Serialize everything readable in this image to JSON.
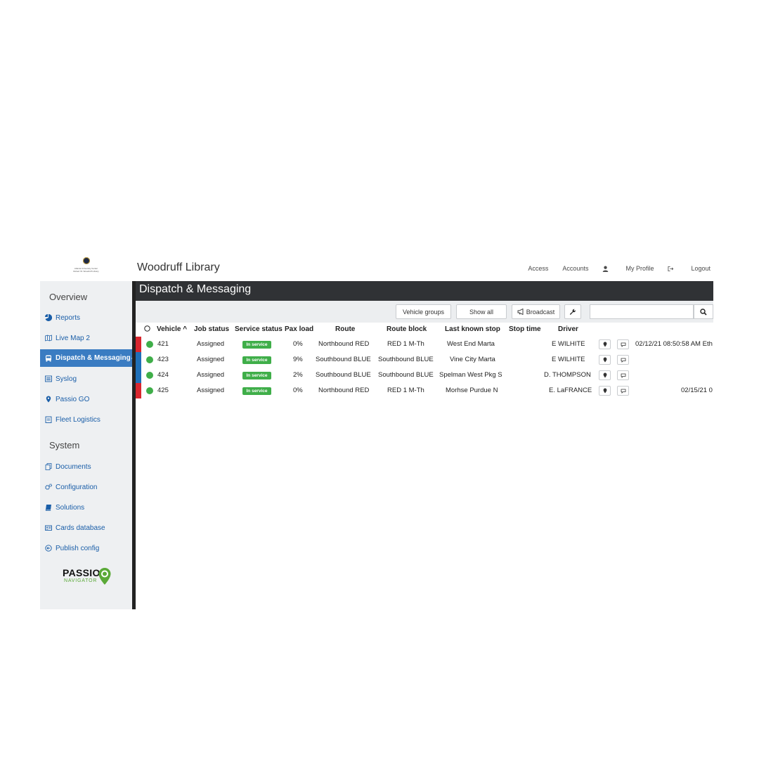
{
  "logo": {
    "caption_1": "Atlanta University Center",
    "caption_2": "Robert W. Woodruff Library"
  },
  "sidebar": {
    "overview_heading": "Overview",
    "system_heading": "System",
    "overview_items": [
      {
        "label": "Reports",
        "icon": "pie-chart-icon"
      },
      {
        "label": "Live Map 2",
        "icon": "map-icon"
      },
      {
        "label": "Dispatch & Messaging",
        "icon": "bus-icon",
        "active": true
      },
      {
        "label": "Syslog",
        "icon": "list-icon"
      },
      {
        "label": "Passio GO",
        "icon": "map-marker-icon"
      },
      {
        "label": "Fleet Logistics",
        "icon": "clipboard-icon"
      }
    ],
    "system_items": [
      {
        "label": "Documents",
        "icon": "documents-icon"
      },
      {
        "label": "Configuration",
        "icon": "cogs-icon"
      },
      {
        "label": "Solutions",
        "icon": "book-icon"
      },
      {
        "label": "Cards database",
        "icon": "id-card-icon"
      },
      {
        "label": "Publish config",
        "icon": "circle-arrow-icon"
      }
    ],
    "brand_word": "PASSIO",
    "brand_sub": "NAVIGATOR"
  },
  "header": {
    "app_title": "Woodruff Library",
    "nav": {
      "access": "Access",
      "accounts": "Accounts",
      "my_profile": "My Profile",
      "logout": "Logout"
    }
  },
  "page": {
    "title": "Dispatch & Messaging"
  },
  "toolbar": {
    "vehicle_groups": "Vehicle groups",
    "show_all": "Show all",
    "broadcast": "Broadcast",
    "search_value": ""
  },
  "table": {
    "columns": {
      "select": "",
      "vehicle": "Vehicle ^",
      "job_status": "Job status",
      "service_status": "Service status",
      "pax_load": "Pax load",
      "route": "Route",
      "route_block": "Route block",
      "last_known_stop": "Last known stop",
      "stop_time": "Stop time",
      "driver": "Driver"
    },
    "rows": [
      {
        "stripe": "#d9262e",
        "vehicle": "421",
        "job_status": "Assigned",
        "service_status": "In service",
        "pax_load": "0%",
        "route": "Northbound RED",
        "route_block": "RED 1 M-Th",
        "last_known_stop": "West End Marta",
        "stop_time": "",
        "driver": "E WILHITE",
        "message": "02/12/21 08:50:58 AM Eth"
      },
      {
        "stripe": "#1f6fb8",
        "vehicle": "423",
        "job_status": "Assigned",
        "service_status": "In service",
        "pax_load": "9%",
        "route": "Southbound BLUE",
        "route_block": "Southbound BLUE",
        "last_known_stop": "Vine City Marta",
        "stop_time": "",
        "driver": "E WILHITE",
        "message": ""
      },
      {
        "stripe": "#1f6fb8",
        "vehicle": "424",
        "job_status": "Assigned",
        "service_status": "In service",
        "pax_load": "2%",
        "route": "Southbound BLUE",
        "route_block": "Southbound BLUE",
        "last_known_stop": "Spelman West Pkg S",
        "stop_time": "",
        "driver": "D. THOMPSON",
        "message": ""
      },
      {
        "stripe": "#d9262e",
        "vehicle": "425",
        "job_status": "Assigned",
        "service_status": "In service",
        "pax_load": "0%",
        "route": "Northbound RED",
        "route_block": "RED 1 M-Th",
        "last_known_stop": "Morhse Purdue N",
        "stop_time": "",
        "driver": "E. LaFRANCE",
        "message": "02/15/21 0"
      }
    ]
  },
  "colors": {
    "active_nav": "#3a7cc2",
    "header_dark": "#303235",
    "in_service": "#3fae49",
    "link": "#1a5ea8",
    "brand_green": "#5aa938"
  }
}
